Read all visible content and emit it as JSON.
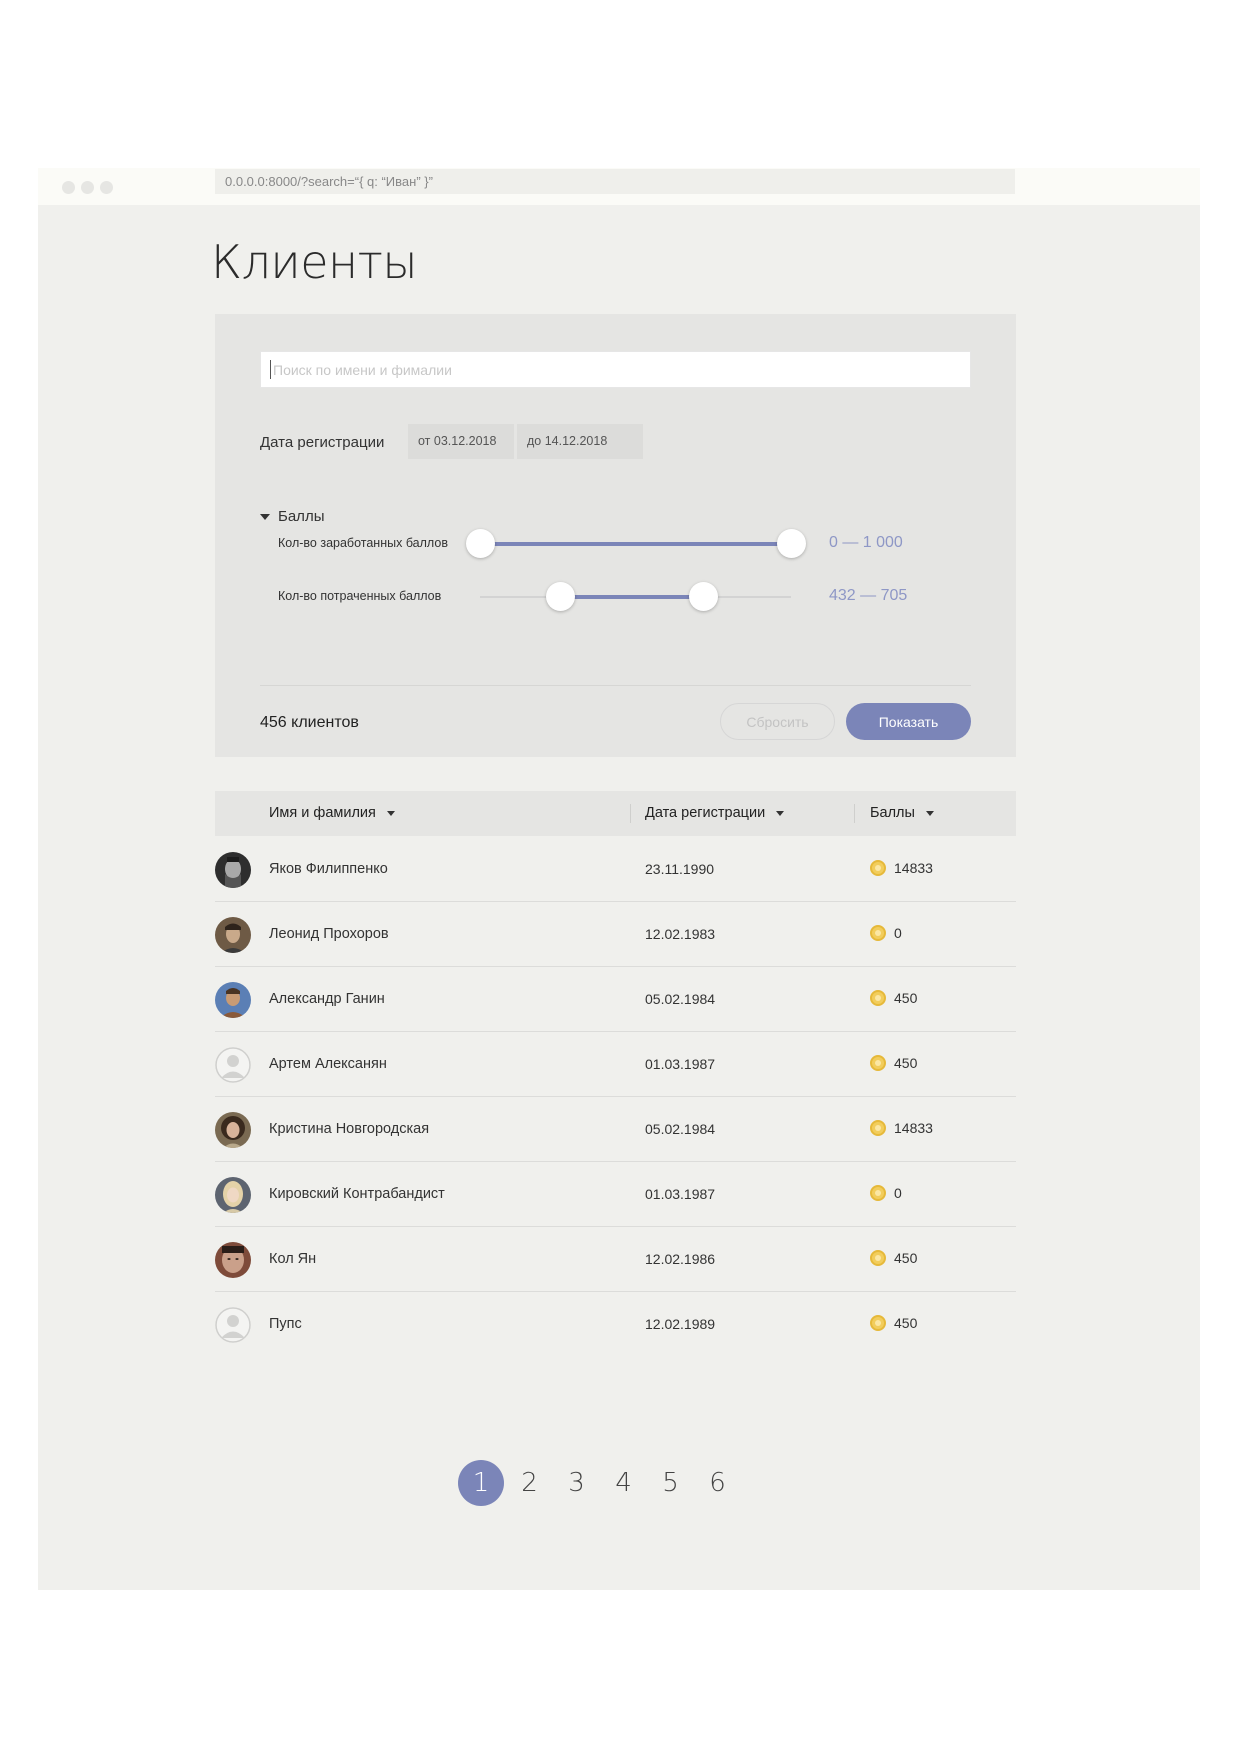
{
  "browser": {
    "url": "0.0.0.0:8000/?search=“{ q: “Иван” }”"
  },
  "page": {
    "title": "Клиенты"
  },
  "filters": {
    "search_placeholder": "Поиск по имени и фималии",
    "search_value": "",
    "date_label": "Дата регистрации",
    "date_from": "от 03.12.2018",
    "date_to": "до 14.12.2018",
    "points_section_label": "Баллы",
    "earned": {
      "label": "Кол-во заработанных баллов",
      "value_text": "0 — 1 000",
      "range_min": 0,
      "range_max": 1000,
      "selected_from": 0,
      "selected_to": 1000
    },
    "spent": {
      "label": "Кол-во потраченных баллов",
      "value_text": "432 — 705",
      "range_min": 0,
      "range_max": 1000,
      "selected_from": 256,
      "selected_to": 718
    },
    "count_text": "456 клиентов",
    "reset_label": "Сбросить",
    "show_label": "Показать"
  },
  "table": {
    "columns": [
      "Имя и фамилия",
      "Дата регистрации",
      "Баллы"
    ],
    "rows": [
      {
        "name": "Яков Филиппенко",
        "date": "23.11.1990",
        "points": "14833",
        "avatar": "photo-dark"
      },
      {
        "name": "Леонид Прохоров",
        "date": "12.02.1983",
        "points": "0",
        "avatar": "photo-brown"
      },
      {
        "name": "Александр Ганин",
        "date": "05.02.1984",
        "points": "450",
        "avatar": "photo-blue"
      },
      {
        "name": "Артем Алексанян",
        "date": "01.03.1987",
        "points": "450",
        "avatar": "placeholder"
      },
      {
        "name": "Кристина Новгородская",
        "date": "05.02.1984",
        "points": "14833",
        "avatar": "photo-curly"
      },
      {
        "name": "Кировский Контрабандист",
        "date": "01.03.1987",
        "points": "0",
        "avatar": "photo-blonde"
      },
      {
        "name": "Кол Ян",
        "date": "12.02.1986",
        "points": "450",
        "avatar": "photo-face"
      },
      {
        "name": "Пупс",
        "date": "12.02.1989",
        "points": "450",
        "avatar": "placeholder"
      }
    ]
  },
  "pagination": {
    "pages": [
      "1",
      "2",
      "3",
      "4",
      "5",
      "6"
    ],
    "current": "1"
  },
  "colors": {
    "accent": "#7b85b8",
    "accent_text": "#8e97c6",
    "panel": "#e5e5e3",
    "background": "#f0f0ed",
    "coin": "#f2cd5c"
  }
}
